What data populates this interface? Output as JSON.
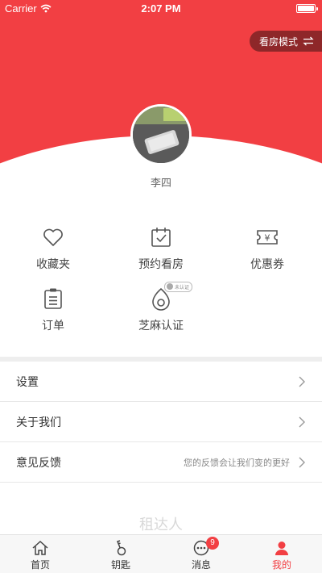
{
  "status_bar": {
    "carrier": "Carrier",
    "time": "2:07 PM",
    "battery": 1.0
  },
  "header": {
    "mode_button": "看房模式"
  },
  "profile": {
    "username": "李四"
  },
  "quick_actions": [
    {
      "label": "收藏夹",
      "icon": "heart-icon"
    },
    {
      "label": "预约看房",
      "icon": "calendar-check-icon"
    },
    {
      "label": "优惠券",
      "icon": "coupon-icon"
    },
    {
      "label": "订单",
      "icon": "clipboard-icon"
    },
    {
      "label": "芝麻认证",
      "icon": "sesame-icon",
      "badge": "未认证"
    }
  ],
  "menu": [
    {
      "title": "设置",
      "hint": ""
    },
    {
      "title": "关于我们",
      "hint": ""
    },
    {
      "title": "意见反馈",
      "hint": "您的反馈会让我们变的更好"
    }
  ],
  "footer_brand": "租达人",
  "tabbar": [
    {
      "label": "首页",
      "icon": "home-icon"
    },
    {
      "label": "钥匙",
      "icon": "key-icon"
    },
    {
      "label": "消息",
      "icon": "message-icon",
      "count": "9"
    },
    {
      "label": "我的",
      "icon": "profile-icon",
      "active": true
    }
  ],
  "colors": {
    "accent": "#f23f43",
    "text": "#333333",
    "muted": "#888888"
  }
}
